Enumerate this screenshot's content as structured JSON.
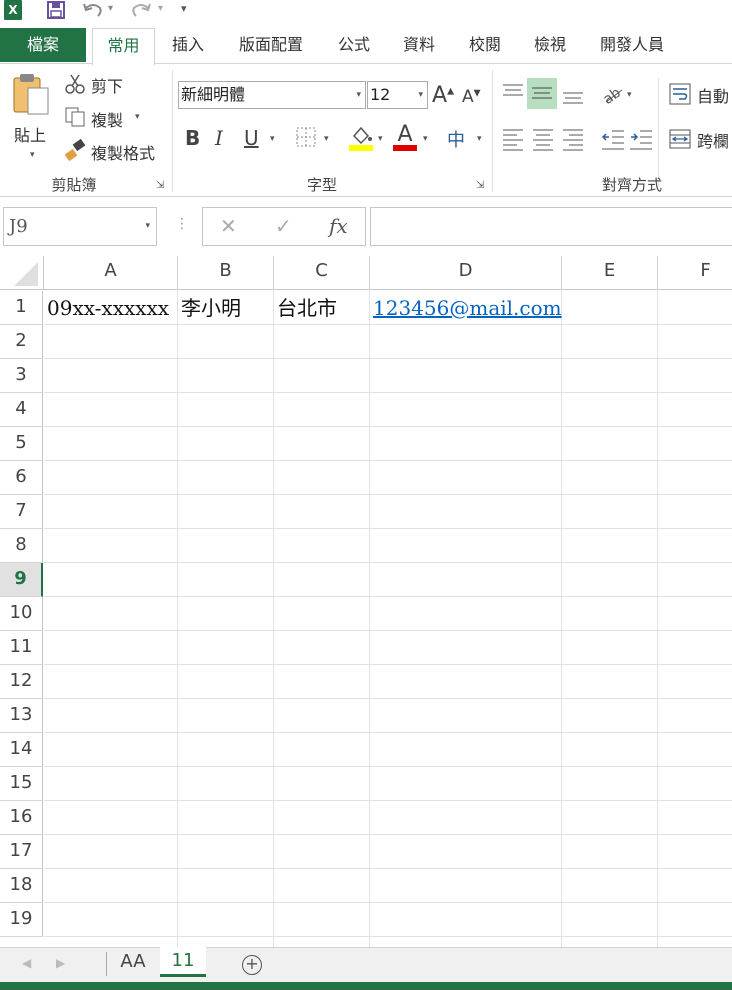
{
  "app": {
    "logo": "X",
    "qat_icons": [
      "excel-logo-icon",
      "save-icon",
      "undo-icon",
      "redo-icon",
      "customize-qat-icon"
    ]
  },
  "tabs": {
    "file": "檔案",
    "items": [
      "常用",
      "插入",
      "版面配置",
      "公式",
      "資料",
      "校閱",
      "檢視",
      "開發人員"
    ],
    "active": "常用"
  },
  "clipboard": {
    "paste": "貼上",
    "cut": "剪下",
    "copy": "複製",
    "format_painter": "複製格式",
    "label": "剪貼簿"
  },
  "font": {
    "name": "新細明體",
    "size": "12",
    "label": "字型",
    "bold": "B",
    "italic": "I",
    "underline": "U",
    "font_color_letter": "A",
    "phonetic": "中"
  },
  "alignment": {
    "label": "對齊方式",
    "wrap": "自動",
    "merge": "跨欄"
  },
  "formula_bar": {
    "name_box": "J9",
    "cancel": "✕",
    "enter": "✓",
    "fx": "fx",
    "value": ""
  },
  "grid": {
    "columns": [
      "A",
      "B",
      "C",
      "D",
      "E",
      "F"
    ],
    "rows": [
      "1",
      "2",
      "3",
      "4",
      "5",
      "6",
      "7",
      "8",
      "9",
      "10",
      "11",
      "12",
      "13",
      "14",
      "15",
      "16",
      "17",
      "18",
      "19"
    ],
    "active_row": "9",
    "row1": {
      "A": "09xx-xxxxxx",
      "B": "李小明",
      "C": "台北市",
      "D": "123456@mail.com"
    }
  },
  "sheets": {
    "items": [
      "AA",
      "11"
    ],
    "active": "11",
    "add": "+"
  },
  "colors": {
    "accent": "#217346",
    "link": "#0563c1",
    "highlight": "#ffff00",
    "font_red": "#e00000",
    "align_active": "#b7dec1"
  }
}
